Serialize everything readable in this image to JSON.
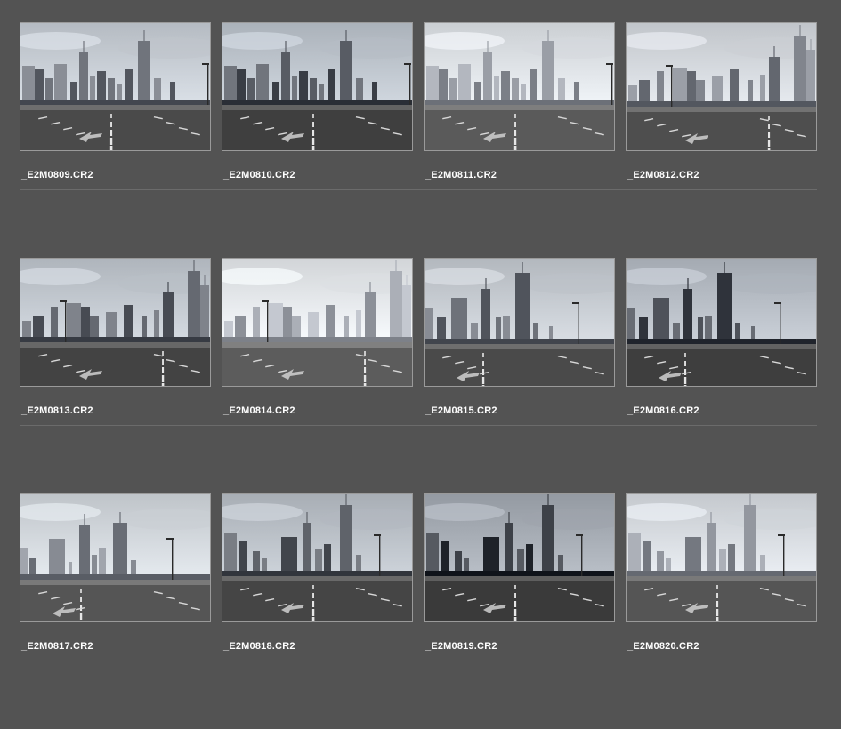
{
  "files": [
    {
      "name": "_E2M0809.CR2",
      "variant": "a"
    },
    {
      "name": "_E2M0810.CR2",
      "variant": "a"
    },
    {
      "name": "_E2M0811.CR2",
      "variant": "a"
    },
    {
      "name": "_E2M0812.CR2",
      "variant": "b"
    },
    {
      "name": "_E2M0813.CR2",
      "variant": "b"
    },
    {
      "name": "_E2M0814.CR2",
      "variant": "b"
    },
    {
      "name": "_E2M0815.CR2",
      "variant": "c"
    },
    {
      "name": "_E2M0816.CR2",
      "variant": "c"
    },
    {
      "name": "_E2M0817.CR2",
      "variant": "d"
    },
    {
      "name": "_E2M0818.CR2",
      "variant": "e"
    },
    {
      "name": "_E2M0819.CR2",
      "variant": "e"
    },
    {
      "name": "_E2M0820.CR2",
      "variant": "e"
    }
  ],
  "tones": [
    {
      "sky": "#c9cfd6",
      "ground": "#4a4a4a",
      "building": "#5c6068",
      "light": 0.0
    },
    {
      "sky": "#bfc6ce",
      "ground": "#3f3f3f",
      "building": "#50545c",
      "light": -0.05
    },
    {
      "sky": "#dfe3e7",
      "ground": "#5a5a5a",
      "building": "#6c7078",
      "light": 0.1
    },
    {
      "sky": "#d5d9de",
      "ground": "#4e4e4e",
      "building": "#60646c",
      "light": 0.05
    },
    {
      "sky": "#c3c9d0",
      "ground": "#434343",
      "building": "#565a62",
      "light": -0.02
    },
    {
      "sky": "#e6e9ec",
      "ground": "#5c5c5c",
      "building": "#70747c",
      "light": 0.15
    },
    {
      "sky": "#c7ccd2",
      "ground": "#4a4a4a",
      "building": "#5a5e66",
      "light": 0.0
    },
    {
      "sky": "#b8bec6",
      "ground": "#3e3e3e",
      "building": "#4e525a",
      "light": -0.08
    },
    {
      "sky": "#d3d8dd",
      "ground": "#555555",
      "building": "#666a72",
      "light": 0.05
    },
    {
      "sky": "#bcc2c9",
      "ground": "#454545",
      "building": "#555960",
      "light": -0.04
    },
    {
      "sky": "#a8aeb6",
      "ground": "#3a3a3a",
      "building": "#474b52",
      "light": -0.12
    },
    {
      "sky": "#d9dde2",
      "ground": "#555555",
      "building": "#6a6e76",
      "light": 0.08
    }
  ]
}
